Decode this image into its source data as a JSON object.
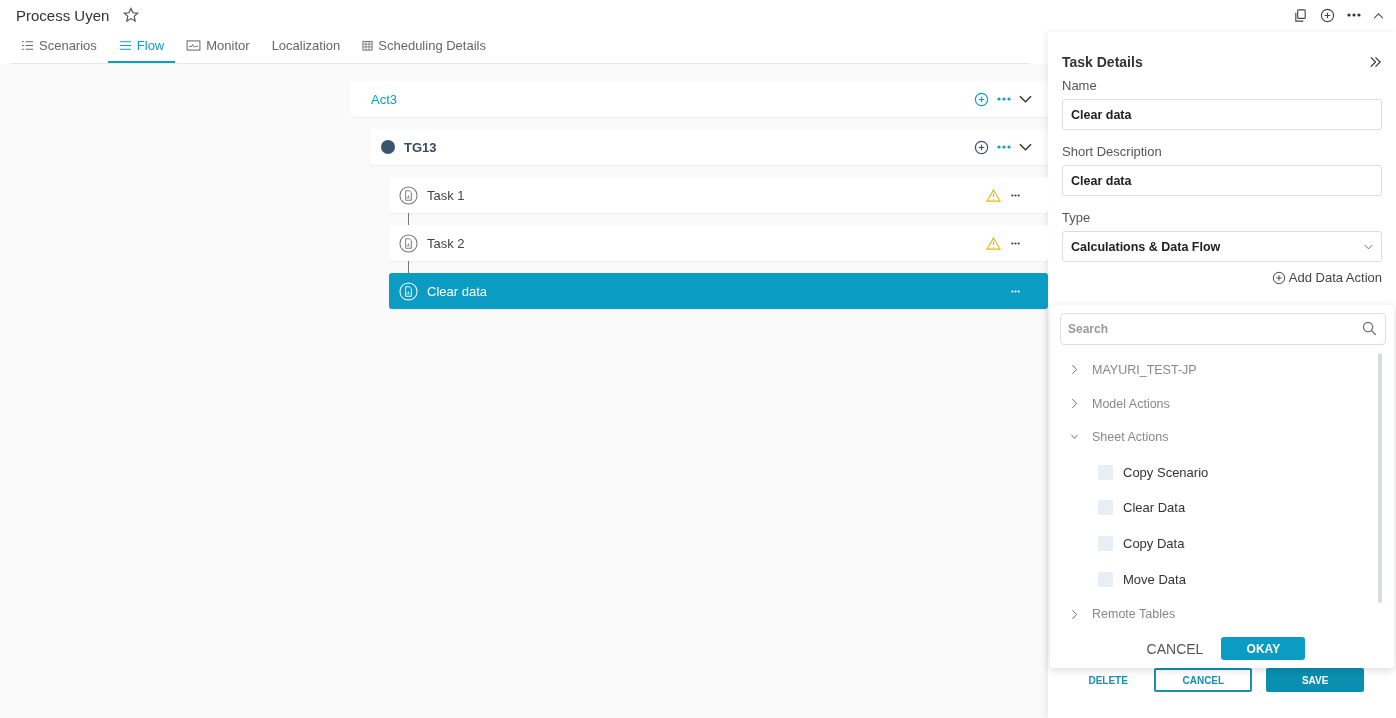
{
  "title": "Process Uyen",
  "starred": false,
  "tabs": [
    {
      "label": "Scenarios",
      "kind": "list",
      "selected": false
    },
    {
      "label": "Flow",
      "kind": "lines",
      "selected": true
    },
    {
      "label": "Monitor",
      "kind": "monitor",
      "selected": false
    },
    {
      "label": "Localization",
      "kind": "plain",
      "selected": false
    },
    {
      "label": "Scheduling Details",
      "kind": "calendar",
      "selected": false
    }
  ],
  "flow": {
    "activity": {
      "label": "Act3",
      "expanded": true
    },
    "group": {
      "label": "TG13",
      "expanded": true,
      "color": "#3a5470"
    },
    "tasks": [
      {
        "label": "Task 1",
        "warning": true,
        "selected": false
      },
      {
        "label": "Task 2",
        "warning": true,
        "selected": false
      },
      {
        "label": "Clear data",
        "warning": false,
        "selected": true
      }
    ]
  },
  "panel": {
    "title": "Task Details",
    "fields": [
      {
        "label": "Name",
        "value": "Clear data"
      },
      {
        "label": "Short Description",
        "value": "Clear data"
      }
    ],
    "type": {
      "label": "Type",
      "value": "Calculations & Data Flow"
    },
    "add_action": "Add Data Action",
    "picker": {
      "search": {
        "placeholder": "Search"
      },
      "groups": [
        {
          "label": "MAYURI_TEST-JP",
          "expanded": false
        },
        {
          "label": "Model Actions",
          "expanded": false
        },
        {
          "label": "Sheet Actions",
          "expanded": true,
          "children": [
            {
              "label": "Copy Scenario",
              "checked": false
            },
            {
              "label": "Clear Data",
              "checked": false
            },
            {
              "label": "Copy Data",
              "checked": false
            },
            {
              "label": "Move Data",
              "checked": false
            }
          ]
        },
        {
          "label": "Remote Tables",
          "expanded": false
        }
      ],
      "cancel": "CANCEL",
      "okay": "OKAY"
    },
    "footer": {
      "delete": "DELETE",
      "cancel": "CANCEL",
      "save": "SAVE"
    }
  }
}
